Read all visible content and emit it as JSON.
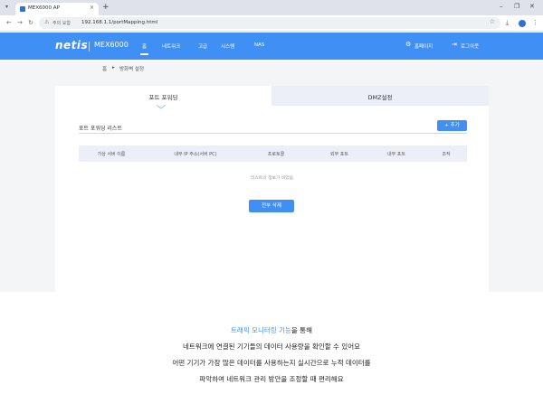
{
  "browser": {
    "tab_title": "MEX6000 AP",
    "tab_close": "×",
    "new_tab": "+",
    "security_label": "주의 요함",
    "url": "192.168.1.1/portMapping.html"
  },
  "app": {
    "logo": "netis",
    "model": "MEX6000",
    "menu": [
      {
        "label": "홈"
      },
      {
        "label": "네트워크"
      },
      {
        "label": "고급"
      },
      {
        "label": "시스템"
      },
      {
        "label": "NAS"
      }
    ],
    "homepage_label": "홈페이지",
    "logout_label": "로그아웃"
  },
  "breadcrumb": {
    "home": "홈",
    "separator": "▸",
    "current": "방화벽 설정"
  },
  "tabs": {
    "port_forwarding": "포트 포워딩",
    "dmz": "DMZ설정"
  },
  "list": {
    "title": "포트 포워딩 리스트",
    "add_button": "+ 추가",
    "columns": [
      "가상 서버 이름",
      "내부 IP 주소(서버 PC)",
      "프로토콜",
      "외부 포트",
      "내부 포트",
      "조작"
    ],
    "empty_message": "리스트의 정보가 비었음",
    "delete_all_button": "전부 삭제"
  },
  "caption": {
    "line1_highlight": "트래픽 모니터링 기능",
    "line1_rest": "을 통해",
    "line2": "네트워크에 연결된 기기들의 데이터 사용량을 확인할 수 있어요",
    "line3": "어떤 기기가 가장 많은 데이터를 사용하는지 실시간으로 누적 데이터를",
    "line4": "파악하여 네트워크 관리 방안을 조정할 때 편리해요"
  },
  "colors": {
    "accent": "#3f8ff5",
    "tab_inactive": "#eceef8"
  },
  "icons": {
    "settings": "gear-icon",
    "logout": "logout-icon"
  }
}
